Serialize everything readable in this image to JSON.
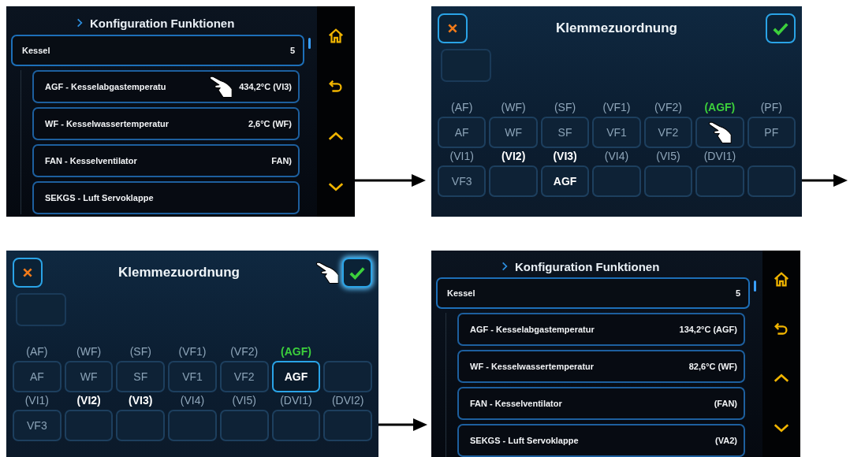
{
  "screens": [
    {
      "kind": "list",
      "title": "Konfiguration Funktionen",
      "group": {
        "label": "Kessel",
        "count": "5"
      },
      "items": [
        {
          "label": "AGF - Kesselabgastemperatu",
          "value": "434,2°C (VI3)",
          "touched": true
        },
        {
          "label": "WF - Kesselwassertemperatur",
          "value": "2,6°C (WF)",
          "touched": false
        },
        {
          "label": "FAN - Kesselventilator",
          "value": "FAN)",
          "touched": false
        },
        {
          "label": "SEKGS - Luft Servoklappe",
          "touched": false
        }
      ]
    },
    {
      "kind": "terminals",
      "title": "Klemmezuordnung",
      "confirm_touched": false,
      "rows": [
        [
          {
            "header": "(AF)",
            "value": "AF",
            "target": false,
            "used": false,
            "selected": false,
            "touched": false
          },
          {
            "header": "(WF)",
            "value": "WF",
            "target": false,
            "used": false,
            "selected": false,
            "touched": false
          },
          {
            "header": "(SF)",
            "value": "SF",
            "target": false,
            "used": false,
            "selected": false,
            "touched": false
          },
          {
            "header": "(VF1)",
            "value": "VF1",
            "target": false,
            "used": false,
            "selected": false,
            "touched": false
          },
          {
            "header": "(VF2)",
            "value": "VF2",
            "target": false,
            "used": false,
            "selected": false,
            "touched": false
          },
          {
            "header": "(AGF)",
            "target": true,
            "used": false,
            "selected": false,
            "touched": true
          },
          {
            "header": "(PF)",
            "value": "PF",
            "target": false,
            "used": false,
            "selected": false,
            "touched": false
          }
        ],
        [
          {
            "header": "(VI1)",
            "value": "VF3",
            "target": false,
            "used": false,
            "selected": false,
            "touched": false
          },
          {
            "header": "(VI2)",
            "target": false,
            "used": true,
            "selected": false,
            "touched": false
          },
          {
            "header": "(VI3)",
            "value": "AGF",
            "target": false,
            "used": true,
            "selected": false,
            "touched": false
          },
          {
            "header": "(VI4)",
            "target": false,
            "used": false,
            "selected": false,
            "touched": false
          },
          {
            "header": "(VI5)",
            "target": false,
            "used": false,
            "selected": false,
            "touched": false
          },
          {
            "header": "(DVI1)",
            "target": false,
            "used": false,
            "selected": false,
            "touched": false
          },
          {
            "selected": false,
            "touched": false
          }
        ]
      ]
    },
    {
      "kind": "terminals",
      "title": "Klemmezuordnung",
      "confirm_touched": true,
      "rows": [
        [
          {
            "header": "(AF)",
            "value": "AF",
            "target": false,
            "used": false,
            "selected": false,
            "touched": false
          },
          {
            "header": "(WF)",
            "value": "WF",
            "target": false,
            "used": false,
            "selected": false,
            "touched": false
          },
          {
            "header": "(SF)",
            "value": "SF",
            "target": false,
            "used": false,
            "selected": false,
            "touched": false
          },
          {
            "header": "(VF1)",
            "value": "VF1",
            "target": false,
            "used": false,
            "selected": false,
            "touched": false
          },
          {
            "header": "(VF2)",
            "value": "VF2",
            "target": false,
            "used": false,
            "selected": false,
            "touched": false
          },
          {
            "header": "(AGF)",
            "value": "AGF",
            "target": true,
            "used": false,
            "selected": true,
            "touched": false
          },
          {
            "selected": false,
            "touched": false
          }
        ],
        [
          {
            "header": "(VI1)",
            "value": "VF3",
            "target": false,
            "used": false,
            "selected": false,
            "touched": false
          },
          {
            "header": "(VI2)",
            "target": false,
            "used": true,
            "selected": false,
            "touched": false
          },
          {
            "header": "(VI3)",
            "target": false,
            "used": true,
            "selected": false,
            "touched": false
          },
          {
            "header": "(VI4)",
            "target": false,
            "used": false,
            "selected": false,
            "touched": false
          },
          {
            "header": "(VI5)",
            "target": false,
            "used": false,
            "selected": false,
            "touched": false
          },
          {
            "header": "(DVI1)",
            "target": false,
            "used": false,
            "selected": false,
            "touched": false
          },
          {
            "header": "(DVI2)",
            "target": false,
            "used": false,
            "selected": false,
            "touched": false
          }
        ]
      ]
    },
    {
      "kind": "list",
      "title": "Konfiguration Funktionen",
      "group": {
        "label": "Kessel",
        "count": "5"
      },
      "items": [
        {
          "label": "AGF - Kesselabgastemperatur",
          "value": "134,2°C (AGF)",
          "touched": false
        },
        {
          "label": "WF - Kesselwassertemperatur",
          "value": "82,6°C (WF)",
          "touched": false
        },
        {
          "label": "FAN - Kesselventilator",
          "value": "(FAN)",
          "touched": false
        },
        {
          "label": "SEKGS - Luft Servoklappe",
          "value": "(VA2)",
          "touched": false
        }
      ]
    }
  ]
}
